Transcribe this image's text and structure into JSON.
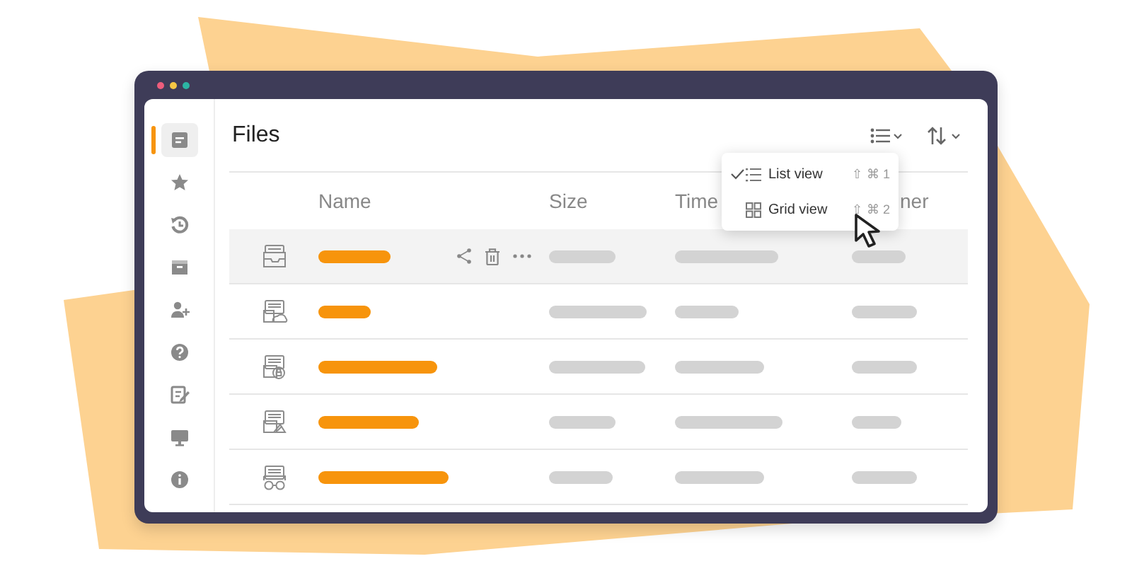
{
  "window": {
    "controls": [
      {
        "color": "#ee5d7c"
      },
      {
        "color": "#f6c744"
      },
      {
        "color": "#2cb5a4"
      }
    ]
  },
  "sidebar": {
    "items": [
      {
        "kind": "document",
        "selected": true
      },
      {
        "kind": "star",
        "selected": false
      },
      {
        "kind": "history",
        "selected": false
      },
      {
        "kind": "archive",
        "selected": false
      },
      {
        "kind": "add-user",
        "selected": false
      },
      {
        "kind": "help",
        "selected": false
      },
      {
        "kind": "edit",
        "selected": false
      },
      {
        "kind": "monitor",
        "selected": false
      },
      {
        "kind": "info",
        "selected": false
      }
    ]
  },
  "title": "Files",
  "view_menu": {
    "items": [
      {
        "kind": "list",
        "label": "List view",
        "shortcut": "⇧ ⌘ 1",
        "selected": true
      },
      {
        "kind": "grid",
        "label": "Grid view",
        "shortcut": "⇧ ⌘ 2",
        "selected": false
      }
    ]
  },
  "table": {
    "columns": [
      "Name",
      "Size",
      "Time",
      "ner"
    ],
    "rows": [
      {
        "kind": "inbox",
        "selected": true
      },
      {
        "kind": "cloud",
        "selected": false
      },
      {
        "kind": "lock",
        "selected": false
      },
      {
        "kind": "edit",
        "selected": false
      },
      {
        "kind": "glasses",
        "selected": false
      }
    ]
  }
}
